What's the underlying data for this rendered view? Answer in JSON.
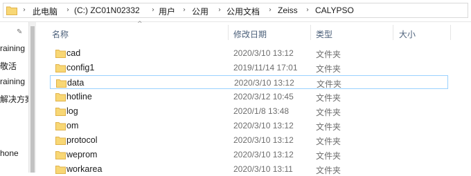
{
  "breadcrumb": [
    "此电脑",
    "(C:) ZC01N02332",
    "用户",
    "公用",
    "公用文档",
    "Zeiss",
    "CALYPSO"
  ],
  "nav_items": [
    "raining",
    "敬活",
    "raining",
    "解决方案",
    "hone"
  ],
  "columns": {
    "name": "名称",
    "modified": "修改日期",
    "type": "类型",
    "size": "大小"
  },
  "rows": [
    {
      "name": "cad",
      "date": "2020/3/10 13:12",
      "type": "文件夹",
      "selected": false
    },
    {
      "name": "config1",
      "date": "2019/11/14 17:01",
      "type": "文件夹",
      "selected": false
    },
    {
      "name": "data",
      "date": "2020/3/10 13:12",
      "type": "文件夹",
      "selected": true
    },
    {
      "name": "hotline",
      "date": "2020/3/12 10:45",
      "type": "文件夹",
      "selected": false
    },
    {
      "name": "log",
      "date": "2020/1/8 13:48",
      "type": "文件夹",
      "selected": false
    },
    {
      "name": "om",
      "date": "2020/3/10 13:12",
      "type": "文件夹",
      "selected": false
    },
    {
      "name": "protocol",
      "date": "2020/3/10 13:12",
      "type": "文件夹",
      "selected": false
    },
    {
      "name": "weprom",
      "date": "2020/3/10 13:12",
      "type": "文件夹",
      "selected": false
    },
    {
      "name": "workarea",
      "date": "2020/3/10 13:11",
      "type": "文件夹",
      "selected": false
    }
  ],
  "colors": {
    "folder": "#f8d775",
    "folder_dark": "#e6b940",
    "selection_border": "#99d1ff",
    "header_text": "#4c607a"
  }
}
